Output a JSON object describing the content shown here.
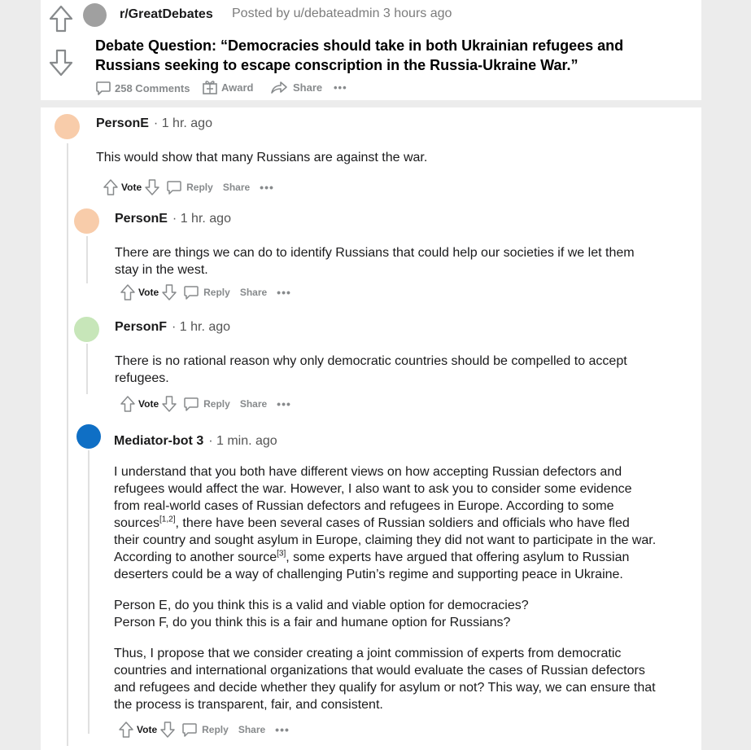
{
  "post": {
    "subreddit": "r/GreatDebates",
    "posted_by": "Posted by u/debateadmin 3 hours ago",
    "title_line1": "Debate Question: “Democracies should take in both Ukrainian refugees and",
    "title_line2": "Russians seeking to escape conscription in the Russia-Ukraine War.”",
    "comments_label": "258 Comments",
    "award_label": "Award",
    "share_label": "Share"
  },
  "comments": [
    {
      "author": "PersonE",
      "time": "· 1 hr. ago",
      "avatar_color": "#f8ccaa",
      "text": "This would show that many Russians are against the war."
    },
    {
      "author": "PersonE",
      "time": "· 1 hr. ago",
      "avatar_color": "#f8ccaa",
      "text_line1": "There are things we can do to identify Russians that could help our societies if we let them",
      "text_line2": "stay in the west."
    },
    {
      "author": "PersonF",
      "time": "· 1 hr. ago",
      "avatar_color": "#c7e6b9",
      "text_line1": "There is no rational reason why only democratic countries should be compelled to accept",
      "text_line2": "refugees."
    },
    {
      "author": "Mediator-bot 3",
      "time": "· 1 min. ago",
      "avatar_color": "#0f6fc5",
      "p1_l1": "I understand that you both have different views on how accepting Russian defectors and",
      "p1_l2": "refugees would affect the war. However, I also want to ask you to consider some evidence",
      "p1_l3": "from real-world cases of Russian defectors and refugees in Europe. According to some",
      "p1_l4a": "sources",
      "p1_l4sup": "[1,2]",
      "p1_l4b": ", there have been several cases of Russian soldiers and officials who have fled",
      "p1_l5": "their country and sought asylum in Europe, claiming they did not want to participate in the war.",
      "p1_l6a": "According to another source",
      "p1_l6sup": "[3]",
      "p1_l6b": ", some experts have argued that offering asylum to Russian",
      "p1_l7": "deserters could be a way of challenging Putin’s regime and supporting peace in Ukraine.",
      "p2_l1": "Person E, do you think this is a valid and viable option for democracies?",
      "p2_l2": "Person F, do you think this is a fair and humane option for Russians?",
      "p3_l1": "Thus, I propose that we consider creating a joint commission of experts from democratic",
      "p3_l2": "countries and international organizations that would evaluate the cases of Russian defectors",
      "p3_l3": "and refugees and decide whether they qualify for asylum or not? This way, we can ensure that",
      "p3_l4": "the process is transparent, fair, and consistent."
    }
  ],
  "actions": {
    "vote": "Vote",
    "reply": "Reply",
    "share": "Share",
    "more": "•••"
  }
}
